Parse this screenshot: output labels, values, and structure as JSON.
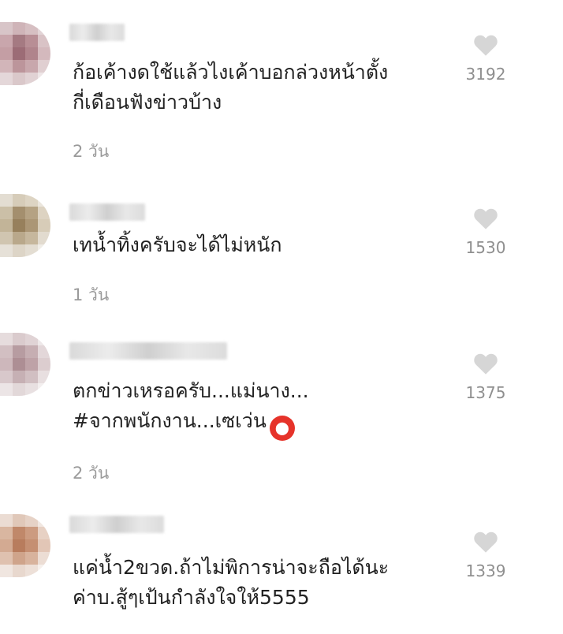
{
  "comments": [
    {
      "lines": [
        "ก้อเค้างดใช้แล้วไงเค้าบอกล่วงหน้าตั้ง",
        "กี่เดือนฟังข่าวบ้าง"
      ],
      "time": "2 วัน",
      "likes": "3192"
    },
    {
      "lines": [
        "เทน้ำทิ้งครับจะได้ไม่หนัก"
      ],
      "time": "1 วัน",
      "likes": "1530"
    },
    {
      "lines": [
        "ตกข่าวเหรอครับ...แม่นาง...",
        "#จากพนักงาน...เซเว่น"
      ],
      "emoji_name": "angry-face-emoji",
      "time": "2 วัน",
      "likes": "1375"
    },
    {
      "lines": [
        "แค่น้ำ2ขวด.ถ้าไม่พิการน่าจะถือได้นะ",
        "ค่าบ.สู้ๆเป้นกำลังใจให้5555"
      ],
      "time": "",
      "likes": "1339"
    }
  ],
  "colors": {
    "text": "#222222",
    "meta": "#9a9a9a",
    "heart": "#d6d6d6",
    "emoji": "#e6332a"
  },
  "icons": {
    "like": "heart-icon",
    "reaction": "angry-face-emoji"
  }
}
